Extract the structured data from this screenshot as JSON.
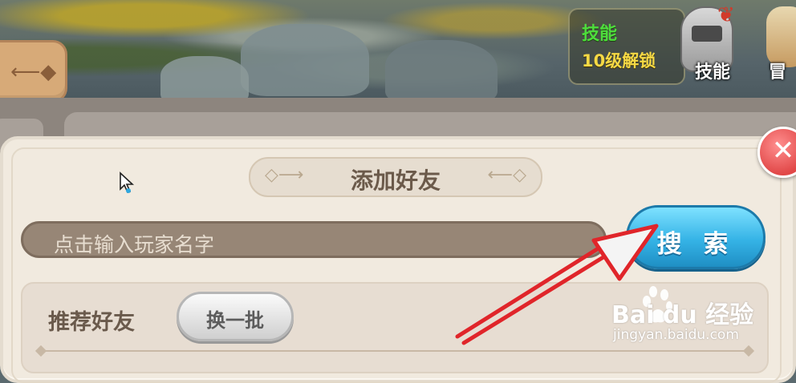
{
  "hud": {
    "skill_title": "技能",
    "skill_unlock": "10级解锁",
    "skill_icon_label": "技能",
    "adventure_icon_label": "冒"
  },
  "dialog": {
    "title": "添加好友",
    "close_glyph": "✕",
    "search": {
      "placeholder": "点击输入玩家名字",
      "button_label": "搜 索"
    },
    "recommend": {
      "title": "推荐好友",
      "refresh_label": "换一批"
    }
  },
  "watermark": {
    "brand": "Bai du 经验",
    "url": "jingyan.baidu.com"
  },
  "colors": {
    "annotation_arrow": "#e0252a",
    "search_button": "#35b3e6",
    "close_button": "#e14848"
  }
}
